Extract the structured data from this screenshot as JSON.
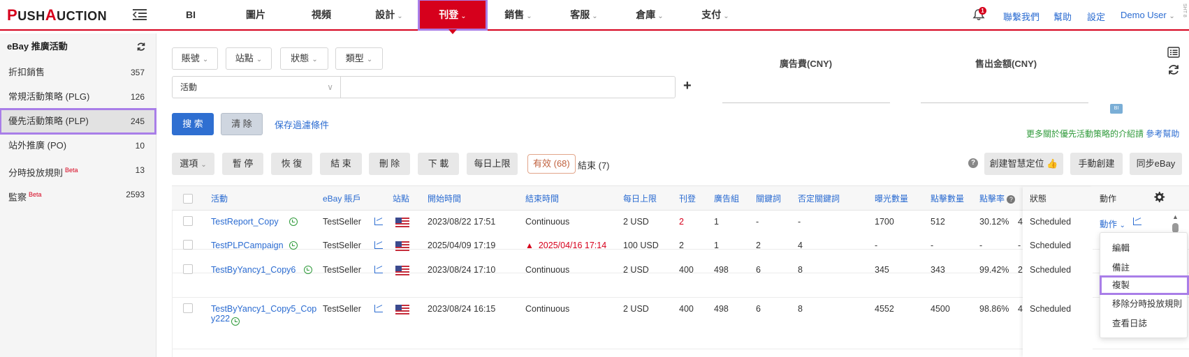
{
  "logo": {
    "p": "P",
    "ush": "USH",
    "a": "A",
    "uction": "UCTION"
  },
  "nav": {
    "items": [
      {
        "label": "BI",
        "chev": ""
      },
      {
        "label": "圖片",
        "chev": ""
      },
      {
        "label": "視頻",
        "chev": ""
      },
      {
        "label": "設計",
        "chev": "⌄"
      },
      {
        "label": "刊登",
        "chev": "⌄"
      },
      {
        "label": "銷售",
        "chev": "⌄"
      },
      {
        "label": "客服",
        "chev": "⌄"
      },
      {
        "label": "倉庫",
        "chev": "⌄"
      },
      {
        "label": "支付",
        "chev": "⌄"
      }
    ],
    "bell_badge": "1",
    "contact": "聯繫我們",
    "help": "幫助",
    "settings": "設定",
    "user": "Demo User",
    "user_chev": "⌄",
    "edge": "SHT 8"
  },
  "sidebar": {
    "title": "eBay 推廣活動",
    "items": [
      {
        "label": "折扣銷售",
        "count": "357",
        "beta": ""
      },
      {
        "label": "常規活動策略 (PLG)",
        "count": "126",
        "beta": ""
      },
      {
        "label": "優先活動策略 (PLP)",
        "count": "245",
        "beta": ""
      },
      {
        "label": "站外推廣 (PO)",
        "count": "10",
        "beta": ""
      },
      {
        "label": "分時投放規則",
        "count": "13",
        "beta": "Beta"
      },
      {
        "label": "監察",
        "count": "2593",
        "beta": "Beta"
      }
    ]
  },
  "filters": {
    "account": "賬號",
    "site": "站點",
    "status": "狀態",
    "type": "類型",
    "chev": "⌄",
    "campaign_select": "活動",
    "select_chev": "∨",
    "plus": "+",
    "search": "搜 索",
    "clear": "清 除",
    "save_filter": "保存過濾條件"
  },
  "metrics": {
    "ad_fee": "廣告費(CNY)",
    "sales": "售出金額(CNY)",
    "mini": "BI"
  },
  "intro": {
    "text": "更多關於優先活動策略的介紹請",
    "link": "參考幫助"
  },
  "toolbar": {
    "options": "選項",
    "pause": "暫 停",
    "resume": "恢 復",
    "end": "結 束",
    "delete": "刪 除",
    "download": "下 載",
    "daily_limit": "每日上限",
    "valid": "有效 (68)",
    "ended": "結束 (7)",
    "help_q": "?",
    "smart": "創建智慧定位 👍",
    "manual": "手動創建",
    "sync": "同步eBay"
  },
  "table": {
    "headers": {
      "activity": "活動",
      "account": "eBay 賬戶",
      "site": "站點",
      "start": "開始時間",
      "end": "結束時間",
      "daily": "每日上限",
      "listing": "刊登",
      "ad_group": "廣告組",
      "keyword": "關鍵詞",
      "neg_keyword": "否定關鍵詞",
      "impressions": "曝光數量",
      "clicks": "點擊數量",
      "ctr": "點擊率",
      "status": "狀態",
      "action": "動作"
    },
    "rows": [
      {
        "name": "TestReport_Copy",
        "name2": "",
        "account": "TestSeller",
        "start": "2023/08/22 17:51",
        "end": "Continuous",
        "end_warn": false,
        "daily": "2 USD",
        "listing": "2",
        "ad_group": "1",
        "keyword": "-",
        "neg": "-",
        "imp": "1700",
        "clicks": "512",
        "ctr": "30.12%",
        "trunc": "4",
        "status": "Scheduled",
        "action": "動作"
      },
      {
        "name": "TestPLPCampaign",
        "name2": "",
        "account": "TestSeller",
        "start": "2025/04/09 17:19",
        "end": "2025/04/16 17:14",
        "end_warn": true,
        "daily": "100 USD",
        "listing": "2",
        "ad_group": "1",
        "keyword": "2",
        "neg": "4",
        "imp": "-",
        "clicks": "-",
        "ctr": "-",
        "trunc": "-",
        "status": "Scheduled",
        "action": ""
      },
      {
        "name": "TestByYancy1_Copy6",
        "name2": "",
        "account": "TestSeller",
        "start": "2023/08/24 17:10",
        "end": "Continuous",
        "end_warn": false,
        "daily": "2 USD",
        "listing": "400",
        "ad_group": "498",
        "keyword": "6",
        "neg": "8",
        "imp": "345",
        "clicks": "343",
        "ctr": "99.42%",
        "trunc": "2",
        "status": "Scheduled",
        "action": ""
      },
      {
        "name": "TestByYancy1_Copy5_Cop",
        "name2": "y222",
        "account": "TestSeller",
        "start": "2023/08/24 16:15",
        "end": "Continuous",
        "end_warn": false,
        "daily": "2 USD",
        "listing": "400",
        "ad_group": "498",
        "keyword": "6",
        "neg": "8",
        "imp": "4552",
        "clicks": "4500",
        "ctr": "98.86%",
        "trunc": "4",
        "status": "Scheduled",
        "action": ""
      }
    ],
    "warn": "▲",
    "chev": "⌄",
    "scroll_up": "▲"
  },
  "dropdown": {
    "items": [
      "編輯",
      "備註",
      "複製",
      "移除分時投放規則",
      "查看日誌"
    ]
  },
  "colors": {
    "brand_red": "#d6001c",
    "link_blue": "#2a6bd1",
    "highlight": "#a97ee8",
    "green": "#2f9a3a"
  }
}
